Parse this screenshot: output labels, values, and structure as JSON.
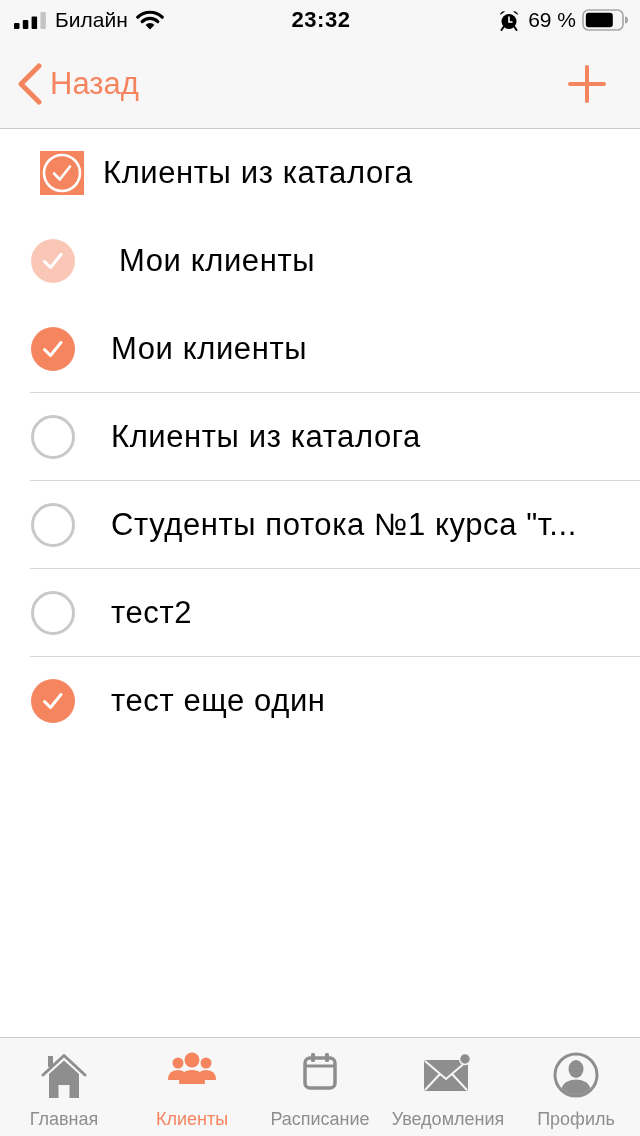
{
  "status_bar": {
    "carrier": "Билайн",
    "time": "23:32",
    "battery": "69 %"
  },
  "nav_bar": {
    "back_label": "Назад"
  },
  "items": [
    {
      "kind": "tile",
      "label": "Клиенты из каталога",
      "checked": true,
      "disabled": false
    },
    {
      "kind": "circle",
      "label": "Мои клиенты",
      "checked": true,
      "disabled": true
    },
    {
      "kind": "circle",
      "label": "Мои клиенты",
      "checked": true,
      "disabled": false
    },
    {
      "kind": "circle",
      "label": "Клиенты из каталога",
      "checked": false,
      "disabled": false
    },
    {
      "kind": "circle",
      "label": "Студенты потока №1 курса \"т...",
      "checked": false,
      "disabled": false
    },
    {
      "kind": "circle",
      "label": "тест2",
      "checked": false,
      "disabled": false
    },
    {
      "kind": "circle",
      "label": "тест еще один",
      "checked": true,
      "disabled": false
    }
  ],
  "tab_bar": [
    {
      "label": "Главная",
      "selected": false
    },
    {
      "label": "Клиенты",
      "selected": true
    },
    {
      "label": "Расписание",
      "selected": false
    },
    {
      "label": "Уведомления",
      "selected": false
    },
    {
      "label": "Профиль",
      "selected": false
    }
  ]
}
